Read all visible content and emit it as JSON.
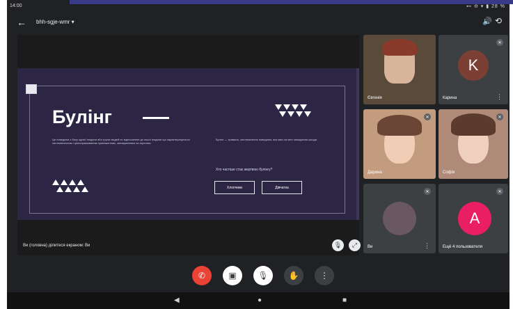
{
  "status": {
    "time": "14:00",
    "system": "⊷ ⊖ ▾ ▮ 28 %"
  },
  "header": {
    "back_icon": "←",
    "meeting_code": "bhh-sgje-wmr ▾",
    "speaker_icon": "🔊",
    "switch_camera_icon": "⟲"
  },
  "presentation": {
    "slide": {
      "title": "Булінг",
      "left_text": "Це поведінка з боку однієї людини або групи людей по відношенню до іншої людини що характеризується систематичним і цілеспрямованим приниженням, залякуванням чи агресією",
      "right_text": "Булінг — тривала, систематична поведінка, яка має на меті заподіяння шкоди",
      "question": "Хто частіше стає жертвою булінгу?",
      "btn_boys": "Хлопчики",
      "btn_girls": "Дівчатка"
    },
    "label": "Ви (головна) ділитеся екраном: Ви"
  },
  "participants": [
    {
      "name": "Євгенія",
      "type": "video",
      "color": "#6b5a4a"
    },
    {
      "name": "Карина",
      "type": "avatar",
      "initial": "K",
      "avatar_color": "#7b3f34"
    },
    {
      "name": "Дарина",
      "type": "video",
      "color": "#c9a28a"
    },
    {
      "name": "Софія",
      "type": "video",
      "color": "#b68b7a"
    },
    {
      "name": "Ви",
      "type": "avatar_img",
      "avatar_color": "#6a5860"
    },
    {
      "name": "Ещё 4 пользователя",
      "type": "avatar",
      "initial": "A",
      "avatar_color": "#e91e63"
    }
  ],
  "controls": {
    "end_call": "✆",
    "camera": "▣",
    "mic": "🎙",
    "raise_hand": "✋",
    "more": "⋮"
  },
  "colors": {
    "end_call_red": "#ea4335",
    "background": "#202124"
  }
}
